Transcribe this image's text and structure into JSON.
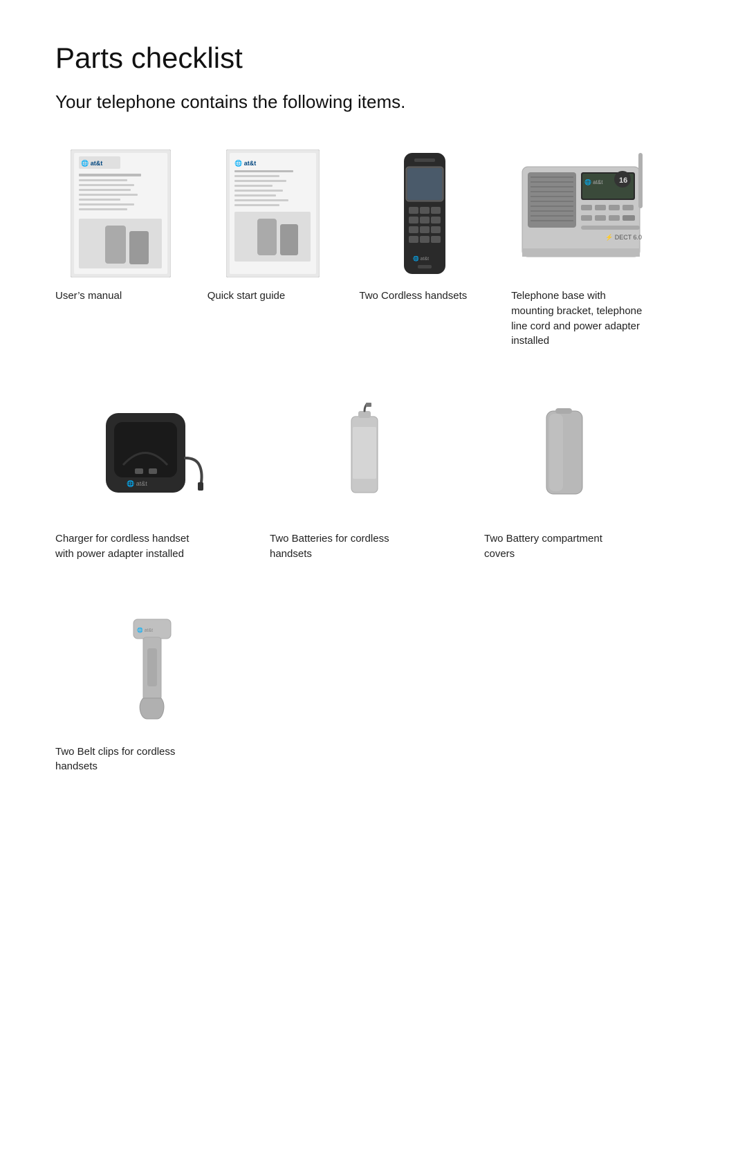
{
  "page": {
    "title": "Parts checklist",
    "subtitle": "Your telephone contains the following items.",
    "items": [
      {
        "id": "users-manual",
        "label": "User’s manual"
      },
      {
        "id": "quick-start-guide",
        "label": "Quick start guide"
      },
      {
        "id": "cordless-handsets",
        "label": "Two Cordless handsets"
      },
      {
        "id": "telephone-base",
        "label": "Telephone base with mounting bracket, telephone line cord and power adapter installed"
      },
      {
        "id": "charger",
        "label": "Charger for cordless handset with power adapter installed"
      },
      {
        "id": "batteries",
        "label": "Two Batteries for cordless handsets"
      },
      {
        "id": "battery-covers",
        "label": "Two Battery compartment covers"
      },
      {
        "id": "belt-clips",
        "label": "Two Belt clips for cordless handsets"
      }
    ]
  }
}
